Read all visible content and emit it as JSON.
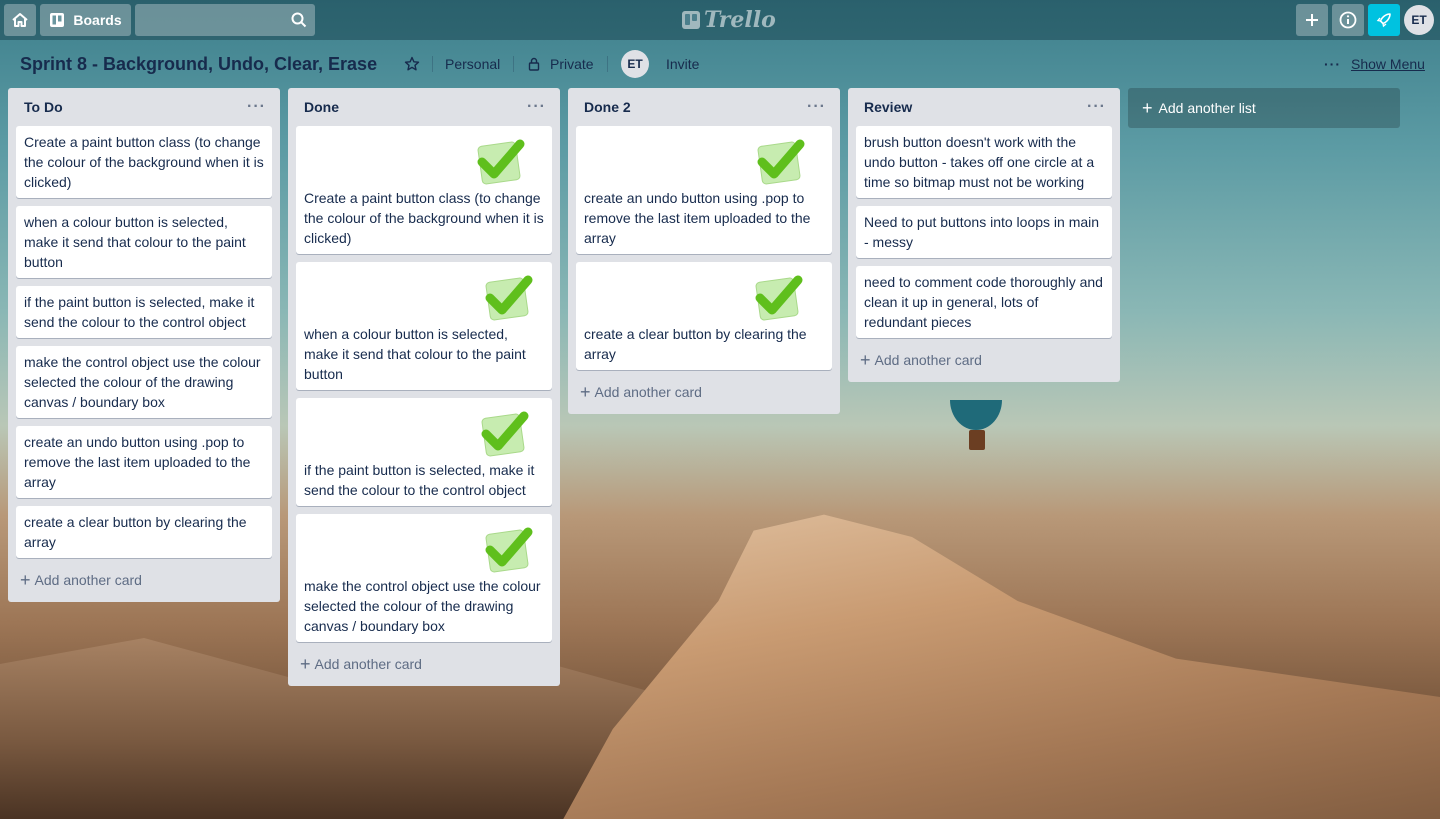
{
  "header": {
    "boards_label": "Boards",
    "logo_text": "Trello",
    "user_initials": "ET"
  },
  "board": {
    "title": "Sprint 8 - Background, Undo, Clear, Erase",
    "team": "Personal",
    "visibility": "Private",
    "member_initials": "ET",
    "invite_label": "Invite",
    "show_menu_label": "Show Menu"
  },
  "lists": [
    {
      "title": "To Do",
      "add_card_label": "Add another card",
      "cards": [
        "Create a paint button class (to change the colour of the background when it is clicked)",
        "when a colour button is selected, make it send that colour to the paint button",
        "if the paint button is selected, make it send the colour to the control object",
        "make the control object use the colour selected the colour of the drawing canvas / boundary box",
        "create an undo button using .pop to remove the last item uploaded to the array",
        "create a clear button by clearing the array"
      ]
    },
    {
      "title": "Done",
      "add_card_label": "Add another card",
      "cards": [
        "Create a paint button class (to change the colour of the background when it is clicked)",
        "when a colour button is selected, make it send that colour to the paint button",
        "if the paint button is selected, make it send the colour to the control object",
        "make the control object use the colour selected the colour of the drawing canvas / boundary box"
      ]
    },
    {
      "title": "Done 2",
      "add_card_label": "Add another card",
      "cards": [
        "create an undo button using .pop to remove the last item uploaded to the array",
        "create a clear button by clearing the array"
      ]
    },
    {
      "title": "Review",
      "add_card_label": "Add another card",
      "cards": [
        "brush button doesn't work with the undo button - takes off one circle at a time so bitmap must not be working",
        "Need to put buttons into loops in main - messy",
        "need to comment code thoroughly and clean it up in general, lots of redundant pieces"
      ]
    }
  ],
  "add_list_label": "Add another list",
  "icons": {
    "home": "home-icon",
    "boards": "boards-icon",
    "search": "search-icon",
    "add": "plus-icon",
    "info": "info-icon",
    "notifications": "rocket-icon",
    "star": "star-icon",
    "lock": "lock-icon",
    "menu": "ellipsis-icon",
    "check_sticker": "checkmark-sticker-icon"
  },
  "colors": {
    "list_bg": "#dfe1e6",
    "text": "#172b4d",
    "accent_notify": "#00c2e0",
    "check_green": "#5fbf1c"
  }
}
